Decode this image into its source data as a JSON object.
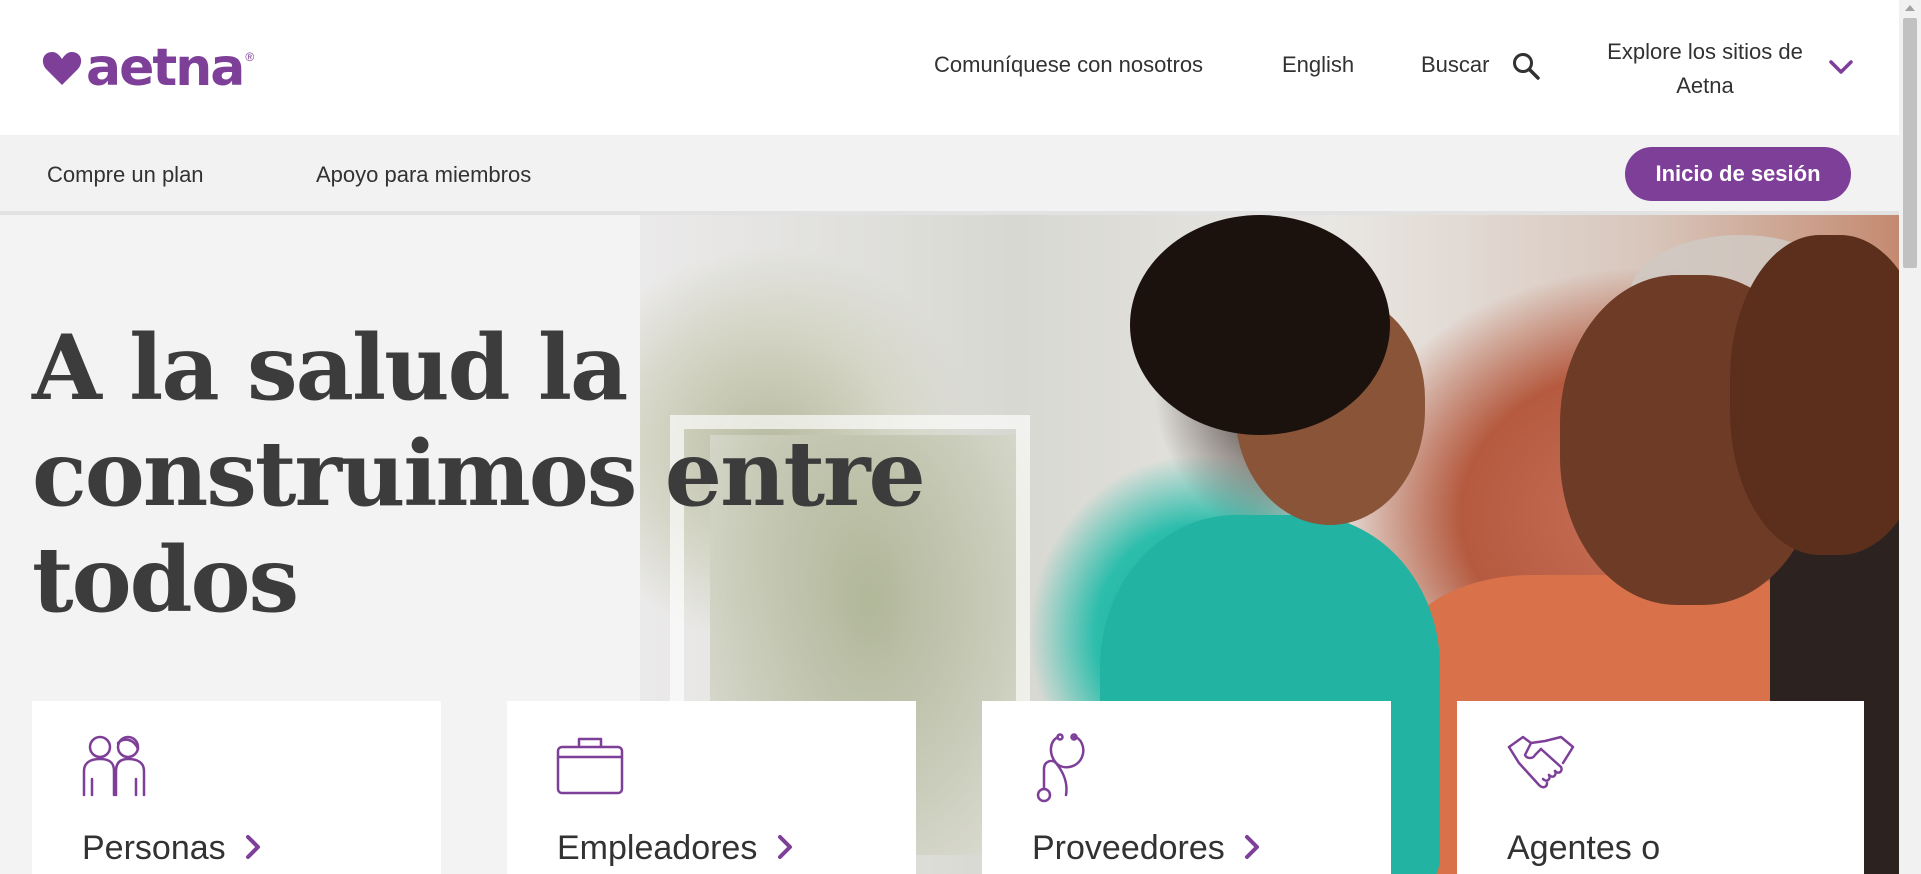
{
  "header": {
    "logo_text": "aetna",
    "logo_mark": "®",
    "contact_label": "Comuníquese con nosotros",
    "language_label": "English",
    "search_label": "Buscar",
    "explore_label": "Explore los sitios de Aetna"
  },
  "nav": {
    "shop_label": "Compre un plan",
    "support_label": "Apoyo para miembros",
    "login_label": "Inicio de sesión"
  },
  "hero": {
    "headline": "A la salud la construimos entre todos"
  },
  "cards": [
    {
      "label": "Personas",
      "icon": "people-icon"
    },
    {
      "label": "Empleadores",
      "icon": "briefcase-icon"
    },
    {
      "label": "Proveedores",
      "icon": "stethoscope-icon"
    },
    {
      "label": "Agentes o",
      "icon": "handshake-icon"
    }
  ],
  "colors": {
    "brand_purple": "#7d3f98",
    "text_dark": "#323232",
    "nav_bg": "#f2f2f2"
  }
}
